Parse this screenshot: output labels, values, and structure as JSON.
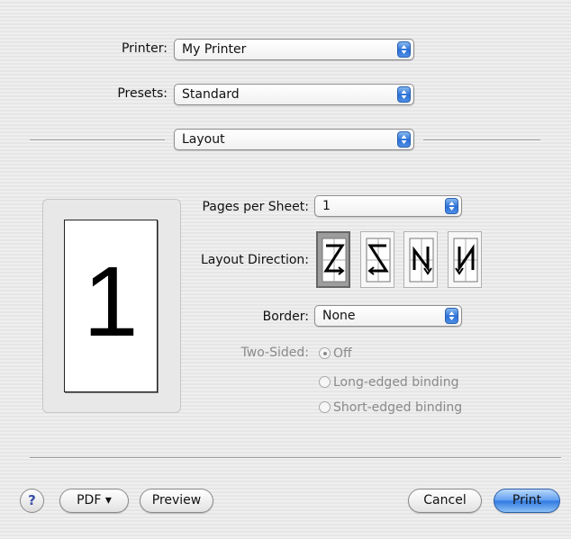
{
  "printer": {
    "label": "Printer:",
    "value": "My Printer"
  },
  "presets": {
    "label": "Presets:",
    "value": "Standard"
  },
  "panel": {
    "value": "Layout"
  },
  "preview": {
    "page_number": "1"
  },
  "layout": {
    "pages_per_sheet": {
      "label": "Pages per Sheet:",
      "value": "1"
    },
    "layout_direction": {
      "label": "Layout Direction:",
      "options": [
        {
          "name": "z-left-right",
          "selected": true
        },
        {
          "name": "z-right-left",
          "selected": false
        },
        {
          "name": "n-top-bottom-left",
          "selected": false
        },
        {
          "name": "n-top-bottom-right",
          "selected": false
        }
      ]
    },
    "border": {
      "label": "Border:",
      "value": "None"
    },
    "two_sided": {
      "label": "Two-Sided:",
      "enabled": false,
      "options": [
        {
          "label": "Off",
          "selected": true
        },
        {
          "label": "Long-edged binding",
          "selected": false
        },
        {
          "label": "Short-edged binding",
          "selected": false
        }
      ]
    }
  },
  "footer": {
    "help_label": "?",
    "pdf_label": "PDF ▾",
    "preview_label": "Preview",
    "cancel_label": "Cancel",
    "print_label": "Print"
  },
  "colors": {
    "accent": "#2f79e0",
    "disabled_text": "#8a8a8a"
  }
}
